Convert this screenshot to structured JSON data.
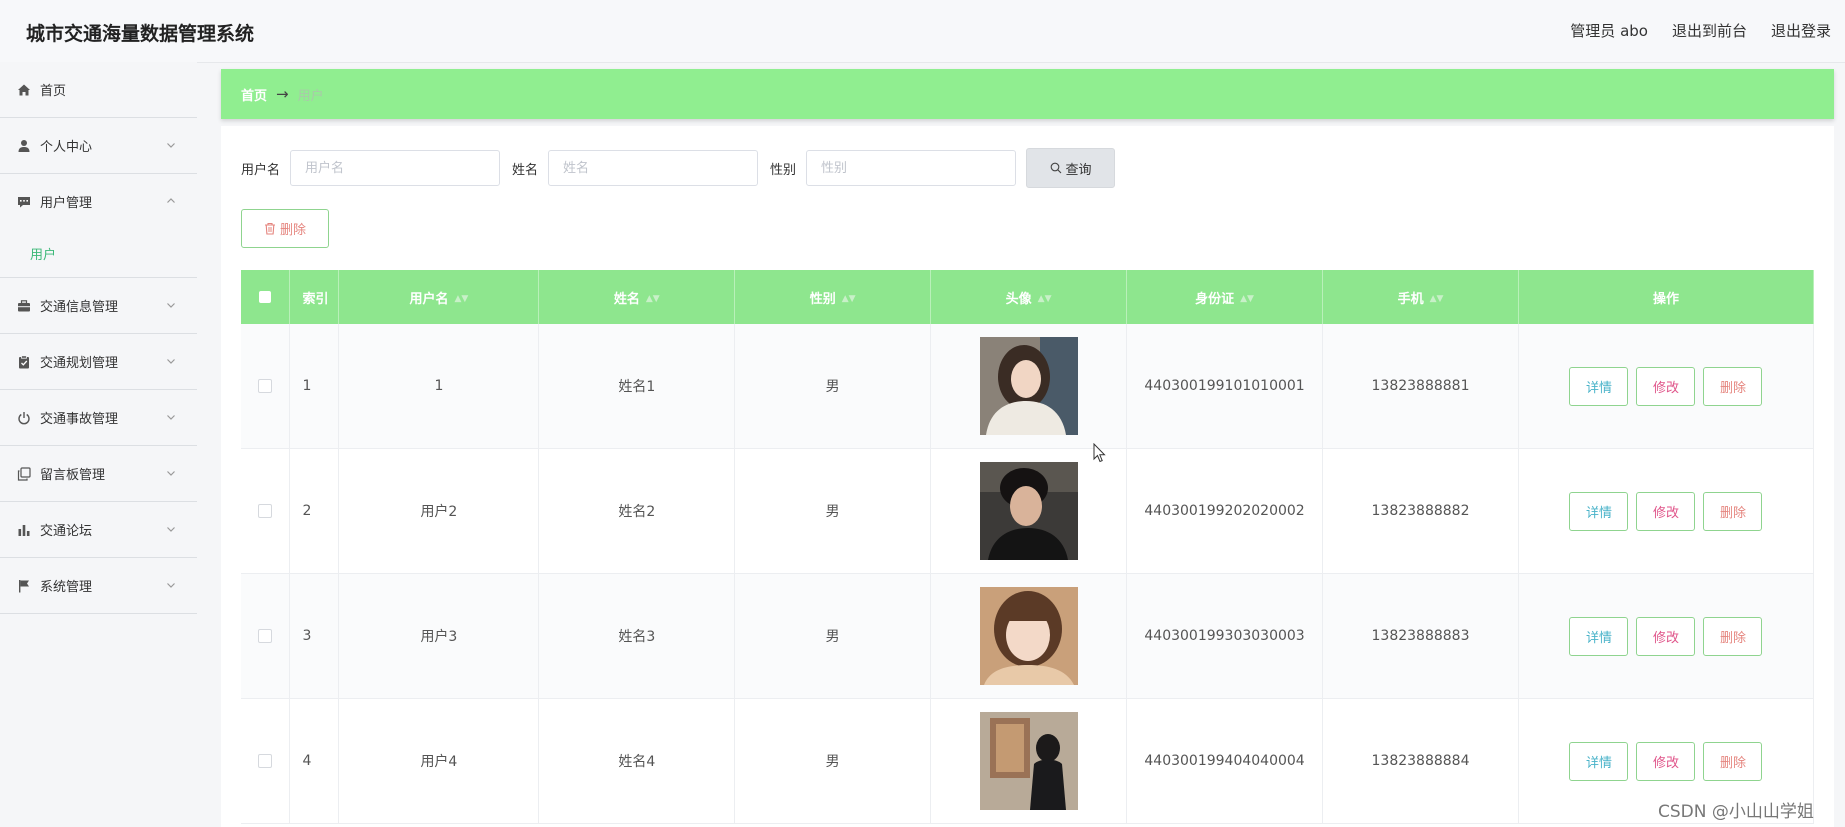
{
  "app": {
    "title": "城市交通海量数据管理系统"
  },
  "top_links": {
    "role": "管理员 abo",
    "to_front": "退出到前台",
    "logout": "退出登录"
  },
  "sidebar": {
    "items": [
      {
        "label": "首页",
        "icon": "home-icon"
      },
      {
        "label": "个人中心",
        "icon": "user-icon"
      },
      {
        "label": "用户管理",
        "icon": "chat-icon",
        "submenu": "用户"
      },
      {
        "label": "交通信息管理",
        "icon": "briefcase-icon"
      },
      {
        "label": "交通规划管理",
        "icon": "clipboard-icon"
      },
      {
        "label": "交通事故管理",
        "icon": "power-icon"
      },
      {
        "label": "留言板管理",
        "icon": "copy-icon"
      },
      {
        "label": "交通论坛",
        "icon": "bar-chart-icon"
      },
      {
        "label": "系统管理",
        "icon": "flag-icon"
      }
    ]
  },
  "breadcrumb": {
    "home": "首页",
    "separator": "→",
    "current": "用户"
  },
  "search": {
    "username_label": "用户名",
    "username_placeholder": "用户名",
    "name_label": "姓名",
    "name_placeholder": "姓名",
    "gender_label": "性别",
    "gender_placeholder": "性别",
    "query_label": "查询"
  },
  "actions": {
    "delete_label": "删除"
  },
  "table": {
    "headers": {
      "index": "索引",
      "username": "用户名",
      "name": "姓名",
      "gender": "性别",
      "avatar": "头像",
      "id_card": "身份证",
      "phone": "手机",
      "ops": "操作"
    },
    "row_buttons": {
      "detail": "详情",
      "edit": "修改",
      "delete": "删除"
    },
    "rows": [
      {
        "index": "1",
        "username": "1",
        "name": "姓名1",
        "gender": "男",
        "id_card": "440300199101010001",
        "phone": "13823888881"
      },
      {
        "index": "2",
        "username": "用户2",
        "name": "姓名2",
        "gender": "男",
        "id_card": "440300199202020002",
        "phone": "13823888882"
      },
      {
        "index": "3",
        "username": "用户3",
        "name": "姓名3",
        "gender": "男",
        "id_card": "440300199303030003",
        "phone": "13823888883"
      },
      {
        "index": "4",
        "username": "用户4",
        "name": "姓名4",
        "gender": "男",
        "id_card": "440300199404040004",
        "phone": "13823888884"
      }
    ]
  },
  "watermark": "CSDN @小山山学姐",
  "colors": {
    "accent": "#90ee90",
    "header": "#8ee68e",
    "link": "#3cb878"
  }
}
